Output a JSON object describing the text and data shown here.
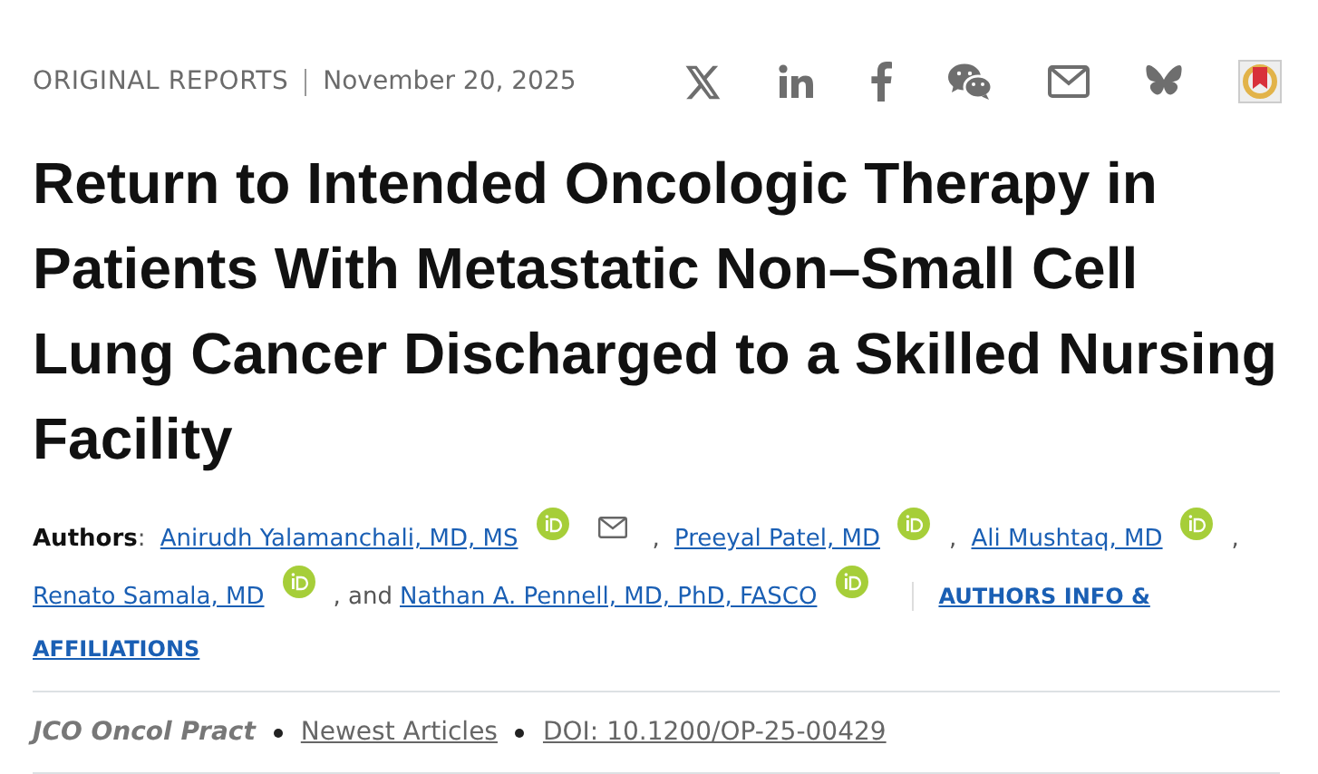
{
  "header": {
    "section": "ORIGINAL REPORTS",
    "date": "November 20, 2025"
  },
  "share": [
    {
      "kind": "x"
    },
    {
      "kind": "linkedin"
    },
    {
      "kind": "facebook"
    },
    {
      "kind": "wechat"
    },
    {
      "kind": "email"
    },
    {
      "kind": "bluesky"
    },
    {
      "kind": "bookmark"
    }
  ],
  "title": "Return to Intended Oncologic Therapy in Patients With Metastatic Non–Small Cell Lung Cancer Discharged to a Skilled Nursing Facility",
  "authors": {
    "label": "Authors",
    "items": [
      {
        "kind": "text",
        "text": ": "
      },
      {
        "kind": "link",
        "text": "Anirudh Yalamanchali, MD, MS"
      },
      {
        "kind": "orcid"
      },
      {
        "kind": "email"
      },
      {
        "kind": "text",
        "text": ", "
      },
      {
        "kind": "link",
        "text": "Preeyal Patel, MD"
      },
      {
        "kind": "orcid"
      },
      {
        "kind": "text",
        "text": ", "
      },
      {
        "kind": "link",
        "text": "Ali Mushtaq, MD"
      },
      {
        "kind": "orcid"
      },
      {
        "kind": "text",
        "text": ","
      },
      {
        "kind": "break"
      },
      {
        "kind": "link",
        "text": "Renato Samala, MD"
      },
      {
        "kind": "orcid"
      },
      {
        "kind": "text",
        "text": ", and"
      },
      {
        "kind": "link",
        "text": "Nathan A. Pennell, MD, PhD, FASCO"
      },
      {
        "kind": "orcid"
      },
      {
        "kind": "divider"
      },
      {
        "kind": "info",
        "text": "AUTHORS INFO &"
      },
      {
        "kind": "break"
      },
      {
        "kind": "info",
        "text": "AFFILIATIONS"
      }
    ]
  },
  "meta": {
    "journal": "JCO Oncol Pract",
    "collection": "Newest Articles",
    "doi": "DOI: 10.1200/OP-25-00429"
  }
}
